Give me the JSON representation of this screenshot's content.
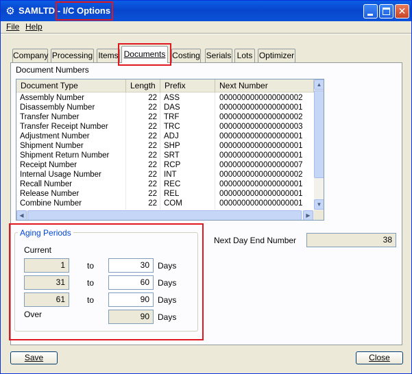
{
  "window": {
    "title_prefix": "SAMLTD - ",
    "title_main": "I/C Options",
    "icon": "gear-icon"
  },
  "menu": {
    "file": "File",
    "help": "Help"
  },
  "tabs": [
    {
      "label": "Company"
    },
    {
      "label": "Processing"
    },
    {
      "label": "Items"
    },
    {
      "label": "Documents"
    },
    {
      "label": "Costing"
    },
    {
      "label": "Serials"
    },
    {
      "label": "Lots"
    },
    {
      "label": "Optimizer"
    }
  ],
  "document_numbers": {
    "label": "Document Numbers",
    "columns": {
      "type": "Document Type",
      "length": "Length",
      "prefix": "Prefix",
      "next": "Next Number"
    },
    "rows": [
      {
        "type": "Assembly Number",
        "length": "22",
        "prefix": "ASS",
        "next": "0000000000000000002"
      },
      {
        "type": "Disassembly Number",
        "length": "22",
        "prefix": "DAS",
        "next": "0000000000000000001"
      },
      {
        "type": "Transfer Number",
        "length": "22",
        "prefix": "TRF",
        "next": "0000000000000000002"
      },
      {
        "type": "Transfer Receipt Number",
        "length": "22",
        "prefix": "TRC",
        "next": "0000000000000000003"
      },
      {
        "type": "Adjustment Number",
        "length": "22",
        "prefix": "ADJ",
        "next": "0000000000000000001"
      },
      {
        "type": "Shipment Number",
        "length": "22",
        "prefix": "SHP",
        "next": "0000000000000000001"
      },
      {
        "type": "Shipment Return Number",
        "length": "22",
        "prefix": "SRT",
        "next": "0000000000000000001"
      },
      {
        "type": "Receipt Number",
        "length": "22",
        "prefix": "RCP",
        "next": "0000000000000000007"
      },
      {
        "type": "Internal Usage Number",
        "length": "22",
        "prefix": "INT",
        "next": "0000000000000000002"
      },
      {
        "type": "Recall Number",
        "length": "22",
        "prefix": "REC",
        "next": "0000000000000000001"
      },
      {
        "type": "Release Number",
        "length": "22",
        "prefix": "REL",
        "next": "0000000000000000001"
      },
      {
        "type": "Combine Number",
        "length": "22",
        "prefix": "COM",
        "next": "0000000000000000001"
      }
    ]
  },
  "next_day_end": {
    "label": "Next Day End Number",
    "value": "38"
  },
  "aging": {
    "title": "Aging Periods",
    "current_label": "Current",
    "to_label": "to",
    "days_label": "Days",
    "over_label": "Over",
    "periods": [
      {
        "from": "1",
        "to": "30"
      },
      {
        "from": "31",
        "to": "60"
      },
      {
        "from": "61",
        "to": "90"
      }
    ],
    "over_value": "90"
  },
  "buttons": {
    "save": "Save",
    "close": "Close"
  },
  "colors": {
    "highlight": "#e0171e",
    "titlebar": "#0846cc",
    "group_title": "#0046d5"
  }
}
